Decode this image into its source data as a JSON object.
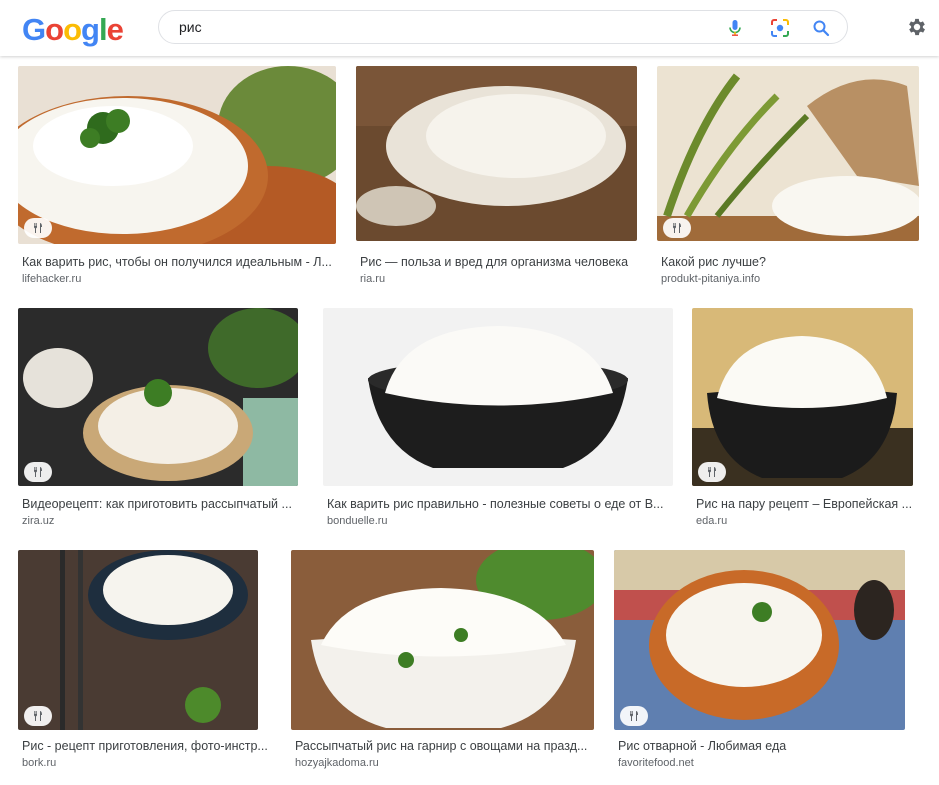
{
  "header": {
    "logo_letters": [
      {
        "ch": "G",
        "color": "#4285F4"
      },
      {
        "ch": "o",
        "color": "#EA4335"
      },
      {
        "ch": "o",
        "color": "#FBBC05"
      },
      {
        "ch": "g",
        "color": "#4285F4"
      },
      {
        "ch": "l",
        "color": "#34A853"
      },
      {
        "ch": "e",
        "color": "#EA4335"
      }
    ],
    "search_value": "рис"
  },
  "results": [
    {
      "title": "Как варить рис, чтобы он получился идеальным - Л...",
      "source": "lifehacker.ru",
      "recipe": true
    },
    {
      "title": "Рис — польза и вред для организма человека",
      "source": "ria.ru",
      "recipe": false
    },
    {
      "title": "Какой рис лучше?",
      "source": "produkt-pitaniya.info",
      "recipe": true
    },
    {
      "title": "Видеорецепт: как приготовить рассыпчатый ...",
      "source": "zira.uz",
      "recipe": true
    },
    {
      "title": "Как варить рис правильно - полезные советы о еде от B...",
      "source": "bonduelle.ru",
      "recipe": false
    },
    {
      "title": "Рис на пару рецепт – Европейская ...",
      "source": "eda.ru",
      "recipe": true
    },
    {
      "title": "Рис - рецепт приготовления, фото-инстр...",
      "source": "bork.ru",
      "recipe": true
    },
    {
      "title": "Рассыпчатый рис на гарнир с овощами на празд...",
      "source": "hozyajkadoma.ru",
      "recipe": false
    },
    {
      "title": "Рис отварной - Любимая еда",
      "source": "favoritefood.net",
      "recipe": true
    }
  ]
}
